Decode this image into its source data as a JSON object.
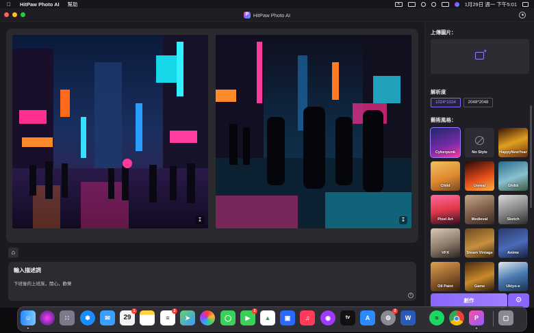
{
  "menubar": {
    "app_name": "HitPaw Photo AI",
    "menu_help": "幫助",
    "clock": "1月29日 週一 下午5:01",
    "input_indicator": "A"
  },
  "window": {
    "title": "HitPaw Photo AI",
    "logo_letter": "P"
  },
  "sidebar": {
    "upload_label": "上傳圖片：",
    "resolution_label": "解析度",
    "resolutions": [
      "1024*1024",
      "2048*2048"
    ],
    "selected_resolution": "1024*1024",
    "style_label": "藝術風格：",
    "styles": [
      {
        "label": "Cyberpunk",
        "selected": true
      },
      {
        "label": "No Style",
        "selected": false
      },
      {
        "label": "HappyNewYear",
        "selected": false
      },
      {
        "label": "Child",
        "selected": false
      },
      {
        "label": "Unreal",
        "selected": false
      },
      {
        "label": "Ghibli",
        "selected": false
      },
      {
        "label": "Pixel Art",
        "selected": false
      },
      {
        "label": "Medieval",
        "selected": false
      },
      {
        "label": "Sketch",
        "selected": false
      },
      {
        "label": "VFX",
        "selected": false
      },
      {
        "label": "Steam Vintage",
        "selected": false
      },
      {
        "label": "Anime",
        "selected": false
      },
      {
        "label": "Oil Paint",
        "selected": false
      },
      {
        "label": "Game",
        "selected": false
      },
      {
        "label": "Ukiyo-e",
        "selected": false
      }
    ],
    "create_label": "創作"
  },
  "prompt": {
    "title": "輸入描述詞",
    "text": "下班後的上班族，開心，歡樂"
  },
  "dock": {
    "calendar_day": "29",
    "badges": {
      "calendar": "1",
      "reminders": "2",
      "facetime": "2",
      "settings": "2"
    }
  },
  "colors": {
    "accent": "#8a66ff",
    "background": "#1b1a20",
    "panel": "#2a2930"
  }
}
